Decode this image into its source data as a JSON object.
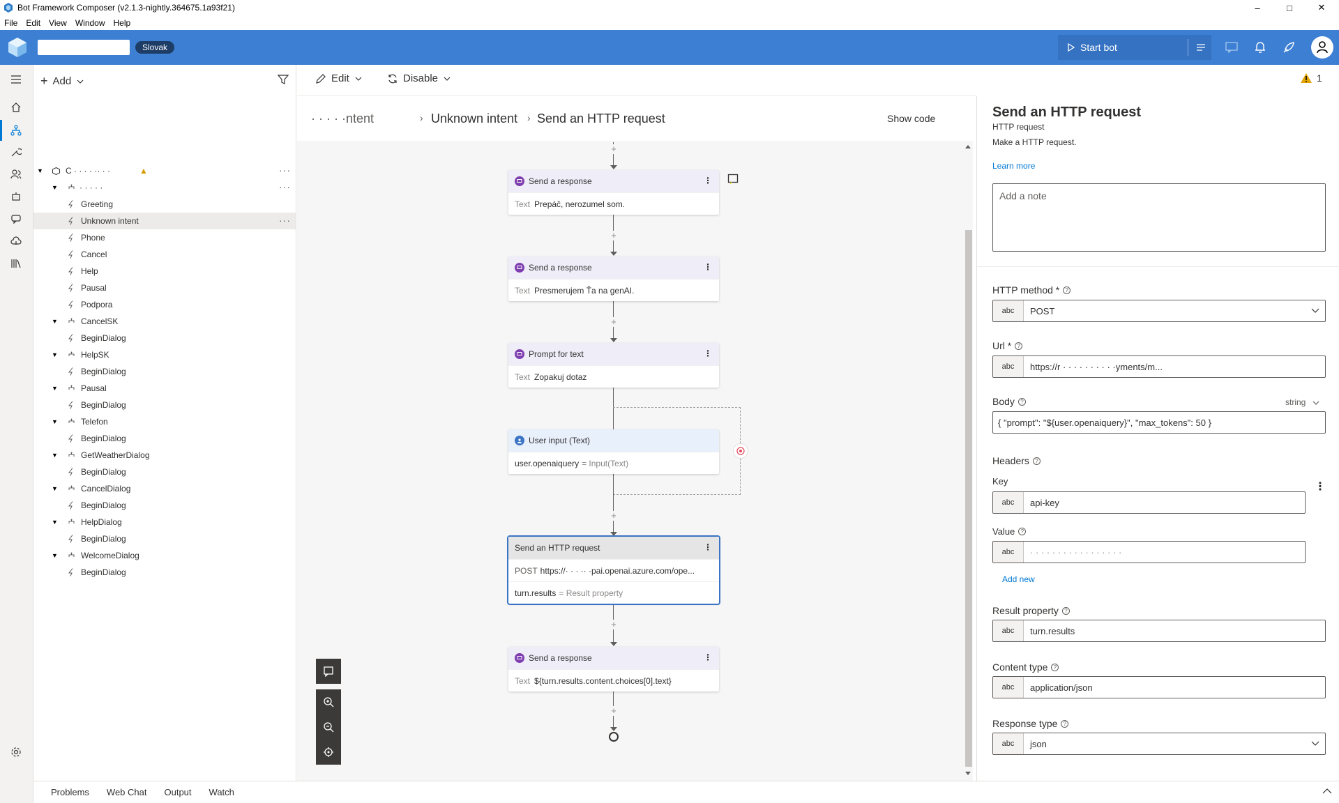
{
  "window": {
    "title": "Bot Framework Composer (v2.1.3-nightly.364675.1a93f21)",
    "controls": [
      "–",
      "□",
      "✕"
    ]
  },
  "menu": [
    "File",
    "Edit",
    "View",
    "Window",
    "Help"
  ],
  "header": {
    "locale": "Slovak",
    "start_bot": "Start bot",
    "brand_color": "#3d7fd3"
  },
  "rail": {
    "icons": [
      "home-icon",
      "bot-flow-icon",
      "wrench-icon",
      "users-icon",
      "robot-icon",
      "chat-icon",
      "cloud-icon",
      "library-icon",
      "settings-icon"
    ]
  },
  "tree": {
    "add_label": "Add",
    "items": [
      {
        "label": "C · · · · ·· · ·",
        "warn": true
      },
      {
        "label": "· · · · ·"
      },
      {
        "label": "Greeting"
      },
      {
        "label": "Unknown intent",
        "selected": true
      },
      {
        "label": "Phone"
      },
      {
        "label": "Cancel"
      },
      {
        "label": "Help"
      },
      {
        "label": "Pausal"
      },
      {
        "label": "Podpora"
      },
      {
        "label": "CancelSK"
      },
      {
        "label": "BeginDialog"
      },
      {
        "label": "HelpSK"
      },
      {
        "label": "BeginDialog"
      },
      {
        "label": "Pausal"
      },
      {
        "label": "BeginDialog"
      },
      {
        "label": "Telefon"
      },
      {
        "label": "BeginDialog"
      },
      {
        "label": "GetWeatherDialog"
      },
      {
        "label": "BeginDialog"
      },
      {
        "label": "CancelDialog"
      },
      {
        "label": "BeginDialog"
      },
      {
        "label": "HelpDialog"
      },
      {
        "label": "BeginDialog"
      },
      {
        "label": "WelcomeDialog"
      },
      {
        "label": "BeginDialog"
      }
    ]
  },
  "toolbar": {
    "edit": "Edit",
    "disable": "Disable",
    "warning_count": "1"
  },
  "breadcrumb": {
    "items": [
      "· · · · ·ntent",
      "Unknown intent",
      "Send an HTTP request"
    ],
    "show_code": "Show code"
  },
  "flow": {
    "nodes": [
      {
        "title": "Send a response",
        "key": "Text",
        "value": "Prepáč, nerozumel som."
      },
      {
        "title": "Send a response",
        "key": "Text",
        "value": "Presmerujem Ťa na genAI."
      },
      {
        "title": "Prompt for text",
        "key": "Text",
        "value": "Zopakuj dotaz"
      },
      {
        "title": "User input (Text)",
        "key": "user.openaiquery",
        "value": "= Input(Text)"
      },
      {
        "title": "Send an HTTP request",
        "key": "POST",
        "value": "https://· · · ·· ·pai.openai.azure.com/ope...",
        "key2": "turn.results",
        "value2": "= Result property"
      },
      {
        "title": "Send a response",
        "key": "Text",
        "value": "${turn.results.content.choices[0].text}"
      }
    ]
  },
  "props": {
    "title": "Send an HTTP request",
    "subtitle": "HTTP request",
    "description": "Make a HTTP request.",
    "learn_more": "Learn more",
    "note_placeholder": "Add a note",
    "method_label": "HTTP method *",
    "method_value": "POST",
    "url_label": "Url *",
    "url_value": "https://r · · · · · · · · · ·yments/m...",
    "body_label": "Body",
    "body_type": "string",
    "body_value": "{  \"prompt\": \"${user.openaiquery}\",    \"max_tokens\": 50 }",
    "headers_label": "Headers",
    "key_label": "Key",
    "key_value": "api-key",
    "value_label": "Value",
    "value_value": "· · · · · · · · · · · · · · · · ·",
    "add_new": "Add new",
    "result_label": "Result property",
    "result_value": "turn.results",
    "content_type_label": "Content type",
    "content_type_value": "application/json",
    "response_type_label": "Response type",
    "response_type_value": "json",
    "abc": "abc"
  },
  "bottom": {
    "tabs": [
      "Problems",
      "Web Chat",
      "Output",
      "Watch"
    ]
  }
}
